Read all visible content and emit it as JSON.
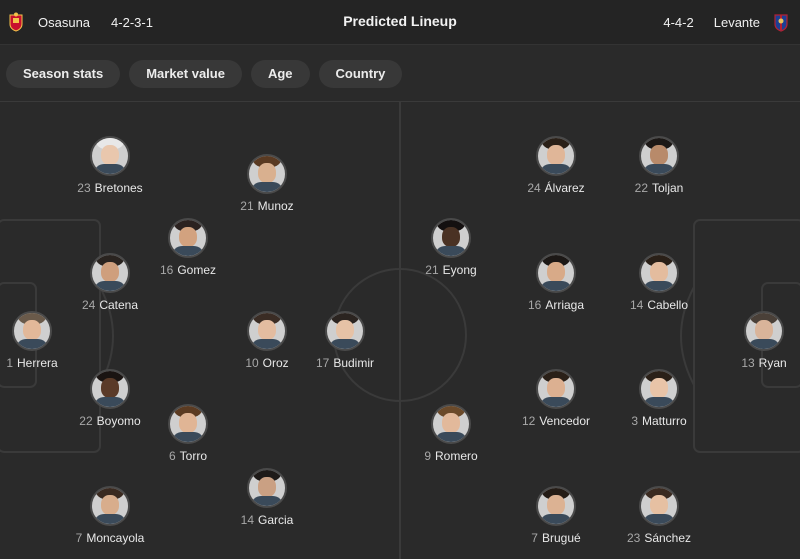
{
  "header": {
    "title": "Predicted Lineup",
    "home": {
      "name": "Osasuna",
      "formation": "4-2-3-1"
    },
    "away": {
      "name": "Levante",
      "formation": "4-4-2"
    }
  },
  "filters": [
    "Season stats",
    "Market value",
    "Age",
    "Country"
  ],
  "colors": {
    "background": "#2a2a2a",
    "osasuna_crest": "#c8102e",
    "levante_crest": "#1c3f94"
  },
  "home_players": [
    {
      "number": "23",
      "name": "Bretones",
      "skin": "#e9c7ad",
      "hair": "#e8e8e8"
    },
    {
      "number": "21",
      "name": "Munoz",
      "skin": "#d9b08f",
      "hair": "#5a3a22"
    },
    {
      "number": "16",
      "name": "Gomez",
      "skin": "#d2a27f",
      "hair": "#2b2220"
    },
    {
      "number": "24",
      "name": "Catena",
      "skin": "#cf9f7d",
      "hair": "#2a2420"
    },
    {
      "number": "1",
      "name": "Herrera",
      "skin": "#e2b899",
      "hair": "#6a5a4a"
    },
    {
      "number": "10",
      "name": "Oroz",
      "skin": "#e3bca0",
      "hair": "#3a2c24"
    },
    {
      "number": "17",
      "name": "Budimir",
      "skin": "#e6c2a6",
      "hair": "#2b2420"
    },
    {
      "number": "22",
      "name": "Boyomo",
      "skin": "#5a3a28",
      "hair": "#1a1412"
    },
    {
      "number": "6",
      "name": "Torro",
      "skin": "#e0b595",
      "hair": "#5b3b22"
    },
    {
      "number": "14",
      "name": "Garcia",
      "skin": "#caa083",
      "hair": "#1e1a18"
    },
    {
      "number": "7",
      "name": "Moncayola",
      "skin": "#d8ad8c",
      "hair": "#3a2a20"
    }
  ],
  "away_players": [
    {
      "number": "24",
      "name": "Álvarez",
      "skin": "#e0b698",
      "hair": "#2a2018"
    },
    {
      "number": "22",
      "name": "Toljan",
      "skin": "#b88a6a",
      "hair": "#1c1816"
    },
    {
      "number": "21",
      "name": "Eyong",
      "skin": "#4a3224",
      "hair": "#141010"
    },
    {
      "number": "16",
      "name": "Arriaga",
      "skin": "#d8aa88",
      "hair": "#1c1816"
    },
    {
      "number": "14",
      "name": "Cabello",
      "skin": "#e4bc9e",
      "hair": "#2a2018"
    },
    {
      "number": "13",
      "name": "Ryan",
      "skin": "#d9b49a",
      "hair": "#4a4038"
    },
    {
      "number": "12",
      "name": "Vencedor",
      "skin": "#dcb091",
      "hair": "#2a2018"
    },
    {
      "number": "3",
      "name": "Matturro",
      "skin": "#e8c4a8",
      "hair": "#2a2018"
    },
    {
      "number": "9",
      "name": "Romero",
      "skin": "#e2b99b",
      "hair": "#6b4a2a"
    },
    {
      "number": "7",
      "name": "Brugué",
      "skin": "#dcb293",
      "hair": "#241c16"
    },
    {
      "number": "23",
      "name": "Sánchez",
      "skin": "#e6c0a2",
      "hair": "#3a2a20"
    }
  ]
}
